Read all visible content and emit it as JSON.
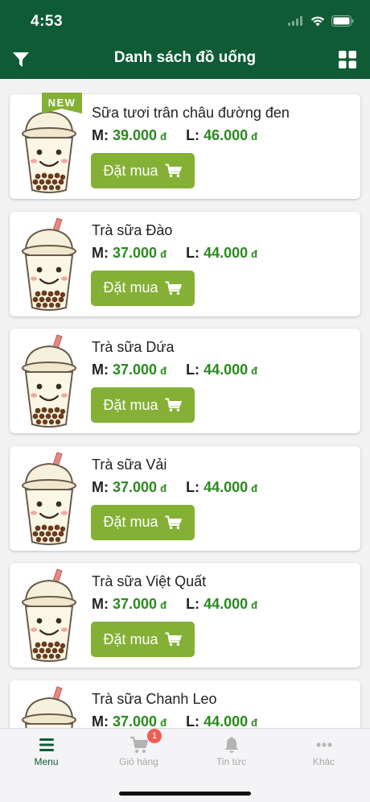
{
  "status_bar": {
    "time": "4:53"
  },
  "header": {
    "title": "Danh sách đồ uống",
    "filter_icon": "filter-icon",
    "view_icon": "grid-view-icon"
  },
  "currency": "đ",
  "size_labels": {
    "m": "M:",
    "l": "L:"
  },
  "order_label": "Đặt mua",
  "new_badge": "NEW",
  "products": [
    {
      "name": "Sữa tươi trân châu đường đen",
      "price_m": "39.000",
      "price_l": "46.000",
      "is_new": true
    },
    {
      "name": "Trà sữa Đào",
      "price_m": "37.000",
      "price_l": "44.000",
      "is_new": false
    },
    {
      "name": "Trà sữa Dứa",
      "price_m": "37.000",
      "price_l": "44.000",
      "is_new": false
    },
    {
      "name": "Trà sữa Vải",
      "price_m": "37.000",
      "price_l": "44.000",
      "is_new": false
    },
    {
      "name": "Trà sữa Việt Quất",
      "price_m": "37.000",
      "price_l": "44.000",
      "is_new": false
    },
    {
      "name": "Trà sữa Chanh Leo",
      "price_m": "37.000",
      "price_l": "44.000",
      "is_new": false
    }
  ],
  "tabbar": {
    "tabs": [
      {
        "label": "Menu",
        "icon": "menu-icon",
        "active": true
      },
      {
        "label": "Giỏ hàng",
        "icon": "cart-icon",
        "badge": "1"
      },
      {
        "label": "Tin tức",
        "icon": "bell-icon"
      },
      {
        "label": "Khác",
        "icon": "more-icon"
      }
    ]
  },
  "colors": {
    "header": "#0f5b36",
    "price": "#2a8a1e",
    "button": "#84b035",
    "badge": "#ef5e55"
  }
}
